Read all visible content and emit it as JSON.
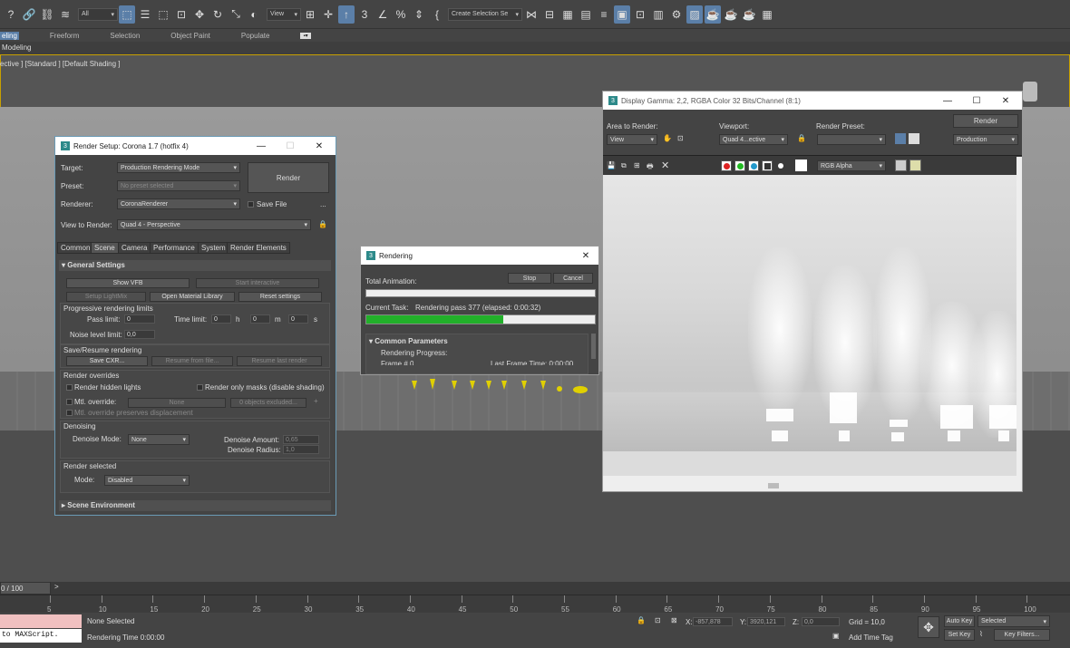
{
  "toolbar": {
    "filter_select": "All",
    "view_select": "View",
    "selection_set": "Create Selection Se"
  },
  "ribbon": {
    "tabs": [
      "eling",
      "Freeform",
      "Selection",
      "Object Paint",
      "Populate"
    ],
    "sub_label": "Modeling"
  },
  "viewport": {
    "label": "ective ] [Standard ] [Default Shading ]"
  },
  "render_setup": {
    "title": "Render Setup: Corona 1.7 (hotfix 4)",
    "target_label": "Target:",
    "target_value": "Production Rendering Mode",
    "preset_label": "Preset:",
    "preset_value": "No preset selected",
    "renderer_label": "Renderer:",
    "renderer_value": "CoronaRenderer",
    "save_file": "Save File",
    "more": "...",
    "render_button": "Render",
    "view_label": "View to Render:",
    "view_value": "Quad 4 - Perspective",
    "tabs": [
      "Common",
      "Scene",
      "Camera",
      "Performance",
      "System",
      "Render Elements"
    ],
    "general_settings": "General Settings",
    "show_vfb": "Show VFB",
    "start_interactive": "Start interactive",
    "setup_lightmix": "Setup LightMix",
    "open_material_library": "Open Material Library",
    "reset_settings": "Reset settings",
    "progressive_limits": "Progressive rendering limits",
    "pass_limit_label": "Pass limit:",
    "pass_limit_value": "0",
    "time_limit_label": "Time limit:",
    "time_h": "0",
    "h": "h",
    "time_m": "0",
    "m": "m",
    "time_s": "0",
    "s": "s",
    "noise_label": "Noise level limit:",
    "noise_value": "0,0",
    "save_resume": "Save/Resume rendering",
    "save_cxr": "Save CXR...",
    "resume_from_file": "Resume from file...",
    "resume_last": "Resume last render",
    "render_overrides": "Render overrides",
    "render_hidden_lights": "Render hidden lights",
    "render_only_masks": "Render only masks (disable shading)",
    "mtl_override": "Mtl. override:",
    "mtl_none": "None",
    "objects_excluded": "0 objects excluded...",
    "plus": "+",
    "mtl_preserves": "Mtl. override preserves displacement",
    "denoising": "Denoising",
    "denoise_mode_label": "Denoise Mode:",
    "denoise_mode_value": "None",
    "denoise_amount_label": "Denoise Amount:",
    "denoise_amount_value": "0,65",
    "denoise_radius_label": "Denoise Radius:",
    "denoise_radius_value": "1,0",
    "render_selected": "Render selected",
    "mode_label": "Mode:",
    "mode_value": "Disabled",
    "scene_environment": "Scene Environment"
  },
  "rendering": {
    "title": "Rendering",
    "total_animation": "Total Animation:",
    "stop": "Stop",
    "cancel": "Cancel",
    "current_task_label": "Current Task:",
    "current_task_value": "Rendering pass 377 (elapsed: 0:00:32)",
    "progress": 0.6,
    "common_parameters": "Common Parameters",
    "rendering_progress": "Rendering Progress:",
    "frame": "Frame  #  0",
    "last_frame_time": "Last Frame Time:  0:00:00"
  },
  "vfb": {
    "title": "Display Gamma: 2,2, RGBA Color 32 Bits/Channel (8:1)",
    "area_label": "Area to Render:",
    "area_value": "View",
    "viewport_label": "Viewport:",
    "viewport_value": "Quad 4...ective",
    "preset_label": "Render Preset:",
    "preset_value": "",
    "render_button": "Render",
    "production": "Production",
    "channel": "RGB Alpha"
  },
  "timeline": {
    "frame": "0 / 100",
    "ticks": [
      "5",
      "10",
      "15",
      "20",
      "25",
      "30",
      "35",
      "40",
      "45",
      "50",
      "55",
      "60",
      "65",
      "70",
      "75",
      "80",
      "85",
      "90",
      "95",
      "100"
    ]
  },
  "status": {
    "maxscript": "to MAXScript.",
    "none_selected": "None Selected",
    "rendering_time": "Rendering Time  0:00:00",
    "x_label": "X:",
    "x_value": "-857,878",
    "y_label": "Y:",
    "y_value": "3920,121",
    "z_label": "Z:",
    "z_value": "0,0",
    "grid": "Grid = 10,0",
    "add_time_tag": "Add Time Tag",
    "auto_key": "Auto Key",
    "selected": "Selected",
    "set_key": "Set Key",
    "key_filters": "Key Filters..."
  }
}
